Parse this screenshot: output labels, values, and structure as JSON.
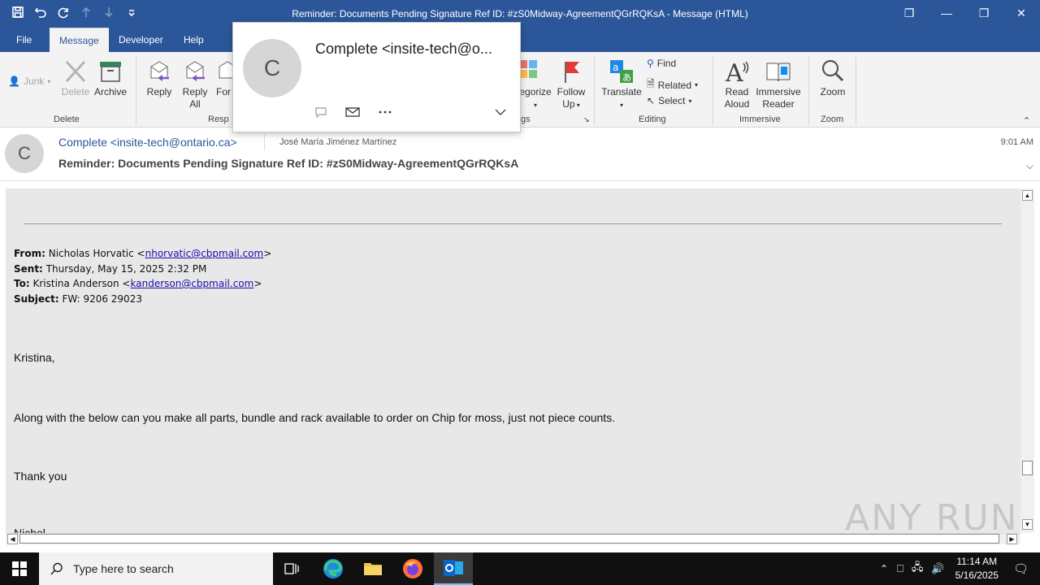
{
  "window": {
    "title": "Reminder: Documents Pending Signature Ref ID: #zS0Midway-AgreementQGrRQKsA  -  Message (HTML)"
  },
  "tabs": [
    "File",
    "Message",
    "Developer",
    "Help"
  ],
  "ribbon": {
    "junk": "Junk",
    "delete": "Delete",
    "archive": "Archive",
    "reply": "Reply",
    "reply_all_1": "Reply",
    "reply_all_2": "All",
    "forward_partial": "For",
    "group_delete": "Delete",
    "group_respond": "Resp",
    "categorize": "egorize",
    "follow_up_1": "Follow",
    "follow_up_2": "Up",
    "tags_label": "gs",
    "translate": "Translate",
    "find": "Find",
    "related": "Related",
    "select": "Select",
    "group_editing": "Editing",
    "read_aloud_1": "Read",
    "read_aloud_2": "Aloud",
    "immersive_1": "Immersive",
    "immersive_2": "Reader",
    "group_immersive": "Immersive",
    "zoom": "Zoom",
    "group_zoom": "Zoom"
  },
  "message": {
    "avatar_letter": "C",
    "sender": "Complete <insite-tech@ontario.ca>",
    "recipient": "José María Jiménez Martínez",
    "time": "9:01 AM",
    "subject": "Reminder: Documents Pending Signature Ref ID: #zS0Midway-AgreementQGrRQKsA"
  },
  "body": {
    "from_label": "From:",
    "from_name": "Nicholas Horvatic <",
    "from_email": "nhorvatic@cbpmail.com",
    "sent_label": "Sent:",
    "sent_value": "Thursday, May 15, 2025 2:32 PM",
    "to_label": "To:",
    "to_name": "Kristina Anderson <",
    "to_email": "kanderson@cbpmail.com",
    "subject_label": "Subject:",
    "subject_value": "FW: 9206  29023",
    "greeting": "Kristina,",
    "paragraph": "Along with the below can you make all parts, bundle and rack available to order on Chip for moss, just not piece counts.",
    "thanks": "Thank you",
    "signature_partial": "Nichol"
  },
  "contact_card": {
    "letter": "C",
    "name": "Complete <insite-tech@o..."
  },
  "watermark": "ANY RUN",
  "taskbar": {
    "search_placeholder": "Type here to search",
    "time": "11:14 AM",
    "date": "5/16/2025"
  }
}
